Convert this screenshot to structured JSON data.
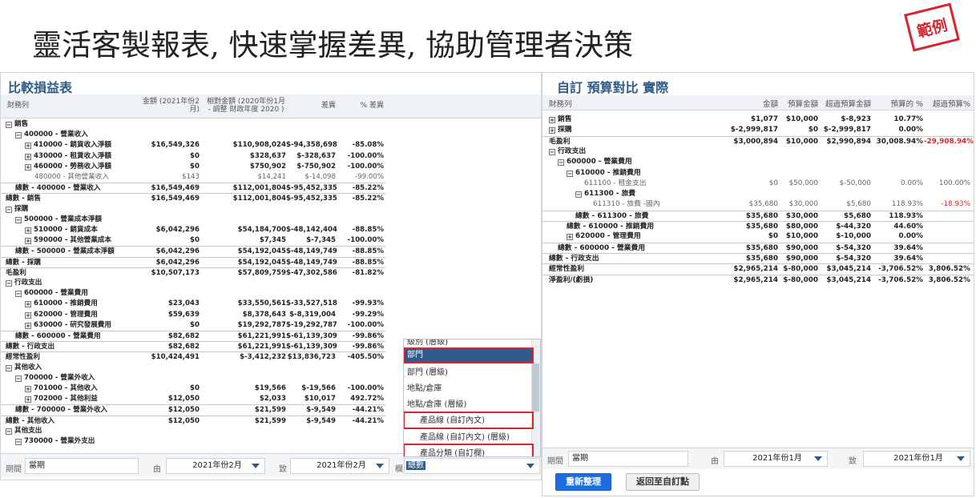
{
  "headline": "靈活客製報表, 快速掌握差異, 協助管理者決策",
  "stamp": "範例",
  "left_report": {
    "title": "比較損益表",
    "columns": {
      "account": "財務列",
      "amount": "金額 (2021年份2月)",
      "compare": "相對金額 (2020年份1月 - 調整 財政年度 2020 )",
      "diff": "差異",
      "pct": "% 差異"
    },
    "rows": [
      {
        "label": "銷售",
        "indent": 0,
        "toggle": "−",
        "amount": "",
        "compare": "",
        "diff": "",
        "pct": "",
        "style": "bold"
      },
      {
        "label": "400000 - 營業收入",
        "indent": 1,
        "toggle": "−",
        "amount": "",
        "compare": "",
        "diff": "",
        "pct": "",
        "style": "bold"
      },
      {
        "label": "410000 - 銷貨收入淨額",
        "indent": 2,
        "toggle": "+",
        "amount": "$16,549,326",
        "compare": "$110,908,024",
        "diff": "$-94,358,698",
        "pct": "-85.08%",
        "style": "bold"
      },
      {
        "label": "430000 - 租賃收入淨額",
        "indent": 2,
        "toggle": "+",
        "amount": "$0",
        "compare": "$328,637",
        "diff": "$-328,637",
        "pct": "-100.00%",
        "style": "bold"
      },
      {
        "label": "460000 - 勞務收入淨額",
        "indent": 2,
        "toggle": "+",
        "amount": "$0",
        "compare": "$750,902",
        "diff": "$-750,902",
        "pct": "-100.00%",
        "style": "bold"
      },
      {
        "label": "480000 - 其他營業收入",
        "indent": 3,
        "toggle": "",
        "amount": "$143",
        "compare": "$14,241",
        "diff": "$-14,098",
        "pct": "-99.00%",
        "style": "light"
      },
      {
        "label": "總數 - 400000 - 營業收入",
        "indent": 1,
        "toggle": "",
        "amount": "$16,549,469",
        "compare": "$112,001,804",
        "diff": "$-95,452,335",
        "pct": "-85.22%",
        "style": "bold total"
      },
      {
        "label": "總數 - 銷售",
        "indent": 0,
        "toggle": "",
        "amount": "$16,549,469",
        "compare": "$112,001,804",
        "diff": "$-95,452,335",
        "pct": "-85.22%",
        "style": "bold total"
      },
      {
        "label": "採購",
        "indent": 0,
        "toggle": "−",
        "amount": "",
        "compare": "",
        "diff": "",
        "pct": "",
        "style": "bold"
      },
      {
        "label": "500000 - 營業成本淨額",
        "indent": 1,
        "toggle": "−",
        "amount": "",
        "compare": "",
        "diff": "",
        "pct": "",
        "style": "bold"
      },
      {
        "label": "510000 - 銷貨成本",
        "indent": 2,
        "toggle": "+",
        "amount": "$6,042,296",
        "compare": "$54,184,700",
        "diff": "$-48,142,404",
        "pct": "-88.85%",
        "style": "bold"
      },
      {
        "label": "590000 - 其他營業成本",
        "indent": 2,
        "toggle": "+",
        "amount": "$0",
        "compare": "$7,345",
        "diff": "$-7,345",
        "pct": "-100.00%",
        "style": "bold"
      },
      {
        "label": "總數 - 500000 - 營業成本淨額",
        "indent": 1,
        "toggle": "",
        "amount": "$6,042,296",
        "compare": "$54,192,045",
        "diff": "$-48,149,749",
        "pct": "-88.85%",
        "style": "bold total"
      },
      {
        "label": "總數 - 採購",
        "indent": 0,
        "toggle": "",
        "amount": "$6,042,296",
        "compare": "$54,192,045",
        "diff": "$-48,149,749",
        "pct": "-88.85%",
        "style": "bold total"
      },
      {
        "label": "毛盈利",
        "indent": 0,
        "toggle": "",
        "amount": "$10,507,173",
        "compare": "$57,809,759",
        "diff": "$-47,302,586",
        "pct": "-81.82%",
        "style": "bold total"
      },
      {
        "label": "行政支出",
        "indent": 0,
        "toggle": "−",
        "amount": "",
        "compare": "",
        "diff": "",
        "pct": "",
        "style": "bold"
      },
      {
        "label": "600000 - 營業費用",
        "indent": 1,
        "toggle": "−",
        "amount": "",
        "compare": "",
        "diff": "",
        "pct": "",
        "style": "bold"
      },
      {
        "label": "610000 - 推銷費用",
        "indent": 2,
        "toggle": "+",
        "amount": "$23,043",
        "compare": "$33,550,561",
        "diff": "$-33,527,518",
        "pct": "-99.93%",
        "style": "bold"
      },
      {
        "label": "620000 - 管理費用",
        "indent": 2,
        "toggle": "+",
        "amount": "$59,639",
        "compare": "$8,378,643",
        "diff": "$-8,319,004",
        "pct": "-99.29%",
        "style": "bold"
      },
      {
        "label": "630000 - 研究發展費用",
        "indent": 2,
        "toggle": "+",
        "amount": "$0",
        "compare": "$19,292,787",
        "diff": "$-19,292,787",
        "pct": "-100.00%",
        "style": "bold"
      },
      {
        "label": "總數 - 600000 - 營業費用",
        "indent": 1,
        "toggle": "",
        "amount": "$82,682",
        "compare": "$61,221,991",
        "diff": "$-61,139,309",
        "pct": "-99.86%",
        "style": "bold total"
      },
      {
        "label": "總數 - 行政支出",
        "indent": 0,
        "toggle": "",
        "amount": "$82,682",
        "compare": "$61,221,991",
        "diff": "$-61,139,309",
        "pct": "-99.86%",
        "style": "bold total"
      },
      {
        "label": "經常性盈利",
        "indent": 0,
        "toggle": "",
        "amount": "$10,424,491",
        "compare": "$-3,412,232",
        "diff": "$13,836,723",
        "pct": "-405.50%",
        "style": "bold total"
      },
      {
        "label": "其他收入",
        "indent": 0,
        "toggle": "−",
        "amount": "",
        "compare": "",
        "diff": "",
        "pct": "",
        "style": "bold"
      },
      {
        "label": "700000 - 營業外收入",
        "indent": 1,
        "toggle": "−",
        "amount": "",
        "compare": "",
        "diff": "",
        "pct": "",
        "style": "bold"
      },
      {
        "label": "701000 - 其他收入",
        "indent": 2,
        "toggle": "+",
        "amount": "$0",
        "compare": "$19,566",
        "diff": "$-19,566",
        "pct": "-100.00%",
        "style": "bold"
      },
      {
        "label": "702000 - 其他利益",
        "indent": 2,
        "toggle": "+",
        "amount": "$12,050",
        "compare": "$2,033",
        "diff": "$10,017",
        "pct": "492.72%",
        "style": "bold"
      },
      {
        "label": "總數 - 700000 - 營業外收入",
        "indent": 1,
        "toggle": "",
        "amount": "$12,050",
        "compare": "$21,599",
        "diff": "$-9,549",
        "pct": "-44.21%",
        "style": "bold total"
      },
      {
        "label": "總數 - 其他收入",
        "indent": 0,
        "toggle": "",
        "amount": "$12,050",
        "compare": "$21,599",
        "diff": "$-9,549",
        "pct": "-44.21%",
        "style": "bold total"
      },
      {
        "label": "其他支出",
        "indent": 0,
        "toggle": "−",
        "amount": "",
        "compare": "",
        "diff": "",
        "pct": "",
        "style": "bold"
      },
      {
        "label": "730000 - 營業外支出",
        "indent": 1,
        "toggle": "−",
        "amount": "",
        "compare": "",
        "diff": "",
        "pct": "",
        "style": "bold"
      }
    ],
    "footer": {
      "period_label": "期間",
      "period_value": "當期",
      "from_label": "由",
      "from_value": "2021年份2月",
      "to_label": "致",
      "to_value": "2021年份2月",
      "col_label": "欄",
      "col_value": "總數"
    },
    "dropdown": {
      "items": [
        "級別 (層級)",
        "部門",
        "部門 (層級)",
        "地點/倉庫",
        "地點/倉庫 (層級)",
        "產品線 (自訂內文)",
        "產品線 (自訂內文) (層級)",
        "產品分類 (自訂欄)"
      ],
      "selected_index": 1,
      "highlighted_indices": [
        1,
        5,
        7
      ]
    }
  },
  "right_report": {
    "title": "自訂 預算對比 實際",
    "columns": {
      "account": "財務列",
      "amount": "金額",
      "budget": "預算金額",
      "over": "超過預算金額",
      "pct_budget": "預算的 %",
      "over_pct": "超過預算%"
    },
    "rows": [
      {
        "label": "銷售",
        "indent": 0,
        "toggle": "+",
        "amount": "$1,077",
        "budget": "$10,000",
        "over": "$-8,923",
        "pct": "10.77%",
        "overpct": "",
        "style": "bold",
        "neg": false
      },
      {
        "label": "採購",
        "indent": 0,
        "toggle": "+",
        "amount": "$-2,999,817",
        "budget": "$0",
        "over": "$-2,999,817",
        "pct": "0.00%",
        "overpct": "",
        "style": "bold",
        "neg": false
      },
      {
        "label": "毛盈利",
        "indent": 0,
        "toggle": "",
        "amount": "$3,000,894",
        "budget": "$10,000",
        "over": "$2,990,894",
        "pct": "30,008.94%",
        "overpct": "-29,908.94%",
        "style": "bold total",
        "neg": true
      },
      {
        "label": "行政支出",
        "indent": 0,
        "toggle": "−",
        "amount": "",
        "budget": "",
        "over": "",
        "pct": "",
        "overpct": "",
        "style": "bold",
        "neg": false
      },
      {
        "label": "600000 - 營業費用",
        "indent": 1,
        "toggle": "−",
        "amount": "",
        "budget": "",
        "over": "",
        "pct": "",
        "overpct": "",
        "style": "bold",
        "neg": false
      },
      {
        "label": "610000 - 推銷費用",
        "indent": 2,
        "toggle": "−",
        "amount": "",
        "budget": "",
        "over": "",
        "pct": "",
        "overpct": "",
        "style": "bold",
        "neg": false
      },
      {
        "label": "611100 - 租金支出",
        "indent": 4,
        "toggle": "",
        "amount": "$0",
        "budget": "$50,000",
        "over": "$-50,000",
        "pct": "0.00%",
        "overpct": "100.00%",
        "style": "light",
        "neg": false
      },
      {
        "label": "611300 - 旅費",
        "indent": 3,
        "toggle": "−",
        "amount": "",
        "budget": "",
        "over": "",
        "pct": "",
        "overpct": "",
        "style": "bold",
        "neg": false
      },
      {
        "label": "611310 - 旅費 -國內",
        "indent": 5,
        "toggle": "",
        "amount": "$35,680",
        "budget": "$30,000",
        "over": "$5,680",
        "pct": "118.93%",
        "overpct": "-18.93%",
        "style": "light",
        "neg": true
      },
      {
        "label": "總數 - 611300 - 旅費",
        "indent": 3,
        "toggle": "",
        "amount": "$35,680",
        "budget": "$30,000",
        "over": "$5,680",
        "pct": "118.93%",
        "overpct": "",
        "style": "bold total",
        "neg": false
      },
      {
        "label": "總數 - 610000 - 推銷費用",
        "indent": 2,
        "toggle": "",
        "amount": "$35,680",
        "budget": "$80,000",
        "over": "$-44,320",
        "pct": "44.60%",
        "overpct": "",
        "style": "bold total",
        "neg": false
      },
      {
        "label": "620000 - 管理費用",
        "indent": 2,
        "toggle": "+",
        "amount": "$0",
        "budget": "$10,000",
        "over": "$-10,000",
        "pct": "0.00%",
        "overpct": "",
        "style": "bold",
        "neg": false
      },
      {
        "label": "總數 - 600000 - 營業費用",
        "indent": 1,
        "toggle": "",
        "amount": "$35,680",
        "budget": "$90,000",
        "over": "$-54,320",
        "pct": "39.64%",
        "overpct": "",
        "style": "bold total",
        "neg": false
      },
      {
        "label": "總數 - 行政支出",
        "indent": 0,
        "toggle": "",
        "amount": "$35,680",
        "budget": "$90,000",
        "over": "$-54,320",
        "pct": "39.64%",
        "overpct": "",
        "style": "bold total",
        "neg": false
      },
      {
        "label": "經常性盈利",
        "indent": 0,
        "toggle": "",
        "amount": "$2,965,214",
        "budget": "$-80,000",
        "over": "$3,045,214",
        "pct": "-3,706.52%",
        "overpct": "3,806.52%",
        "style": "bold total",
        "neg": false
      },
      {
        "label": "淨盈利/(虧損)",
        "indent": 0,
        "toggle": "",
        "amount": "$2,965,214",
        "budget": "$-80,000",
        "over": "$3,045,214",
        "pct": "-3,706.52%",
        "overpct": "3,806.52%",
        "style": "bold total",
        "neg": false
      }
    ],
    "footer": {
      "period_label": "期間",
      "period_value": "當期",
      "from_label": "由",
      "from_value": "2021年份1月",
      "to_label": "致",
      "to_value": "2021年份1月"
    },
    "buttons": {
      "refresh": "重新整理",
      "back": "返回至自訂點"
    }
  },
  "colors": {
    "accent": "#2f5b8a",
    "primary_button": "#1d6ce0",
    "highlight": "#d8252d"
  }
}
